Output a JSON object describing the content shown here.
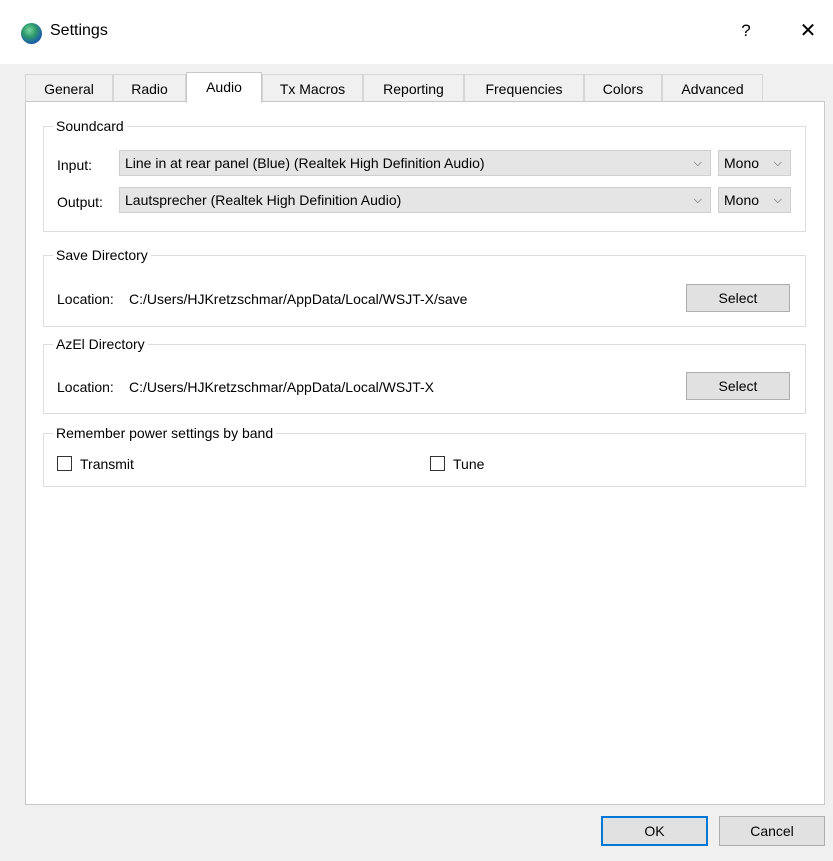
{
  "window": {
    "title": "Settings",
    "help_symbol": "?",
    "close_symbol": "✕"
  },
  "tabs": [
    {
      "label": "General"
    },
    {
      "label": "Radio"
    },
    {
      "label": "Audio",
      "active": true
    },
    {
      "label": "Tx Macros"
    },
    {
      "label": "Reporting"
    },
    {
      "label": "Frequencies"
    },
    {
      "label": "Colors"
    },
    {
      "label": "Advanced"
    }
  ],
  "soundcard": {
    "title": "Soundcard",
    "input_label": "Input:",
    "input_value": "Line in at rear panel (Blue) (Realtek High Definition Audio)",
    "input_channel": "Mono",
    "output_label": "Output:",
    "output_value": "Lautsprecher (Realtek High Definition Audio)",
    "output_channel": "Mono"
  },
  "save_directory": {
    "title": "Save Directory",
    "location_label": "Location:",
    "location_value": "C:/Users/HJKretzschmar/AppData/Local/WSJT-X/save",
    "select_label": "Select"
  },
  "azel_directory": {
    "title": "AzEl Directory",
    "location_label": "Location:",
    "location_value": "C:/Users/HJKretzschmar/AppData/Local/WSJT-X",
    "select_label": "Select"
  },
  "power": {
    "title": "Remember power settings by band",
    "transmit_label": "Transmit",
    "transmit_checked": false,
    "tune_label": "Tune",
    "tune_checked": false
  },
  "footer": {
    "ok_label": "OK",
    "cancel_label": "Cancel"
  },
  "icons": {
    "app": "wsjtx-globe-icon",
    "dropdown": "chevron-down-icon"
  },
  "colors": {
    "accent": "#0078d7"
  }
}
